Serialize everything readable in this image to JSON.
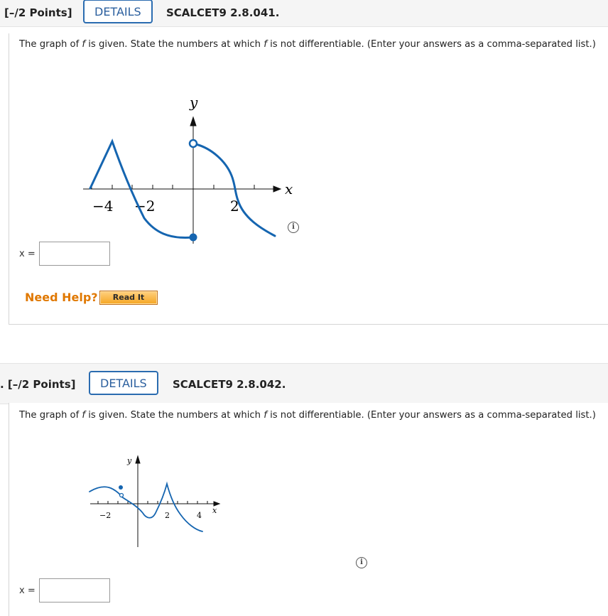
{
  "questions": [
    {
      "points": "[–/2 Points]",
      "details_label": "DETAILS",
      "code": "SCALCET9 2.8.041.",
      "prompt_before": "The graph of ",
      "f_symbol": "f",
      "prompt_middle": " is given. State the numbers at which ",
      "prompt_after": " is not differentiable. (Enter your answers as a comma-separated list.)",
      "graph": {
        "y_label": "y",
        "x_label": "x",
        "tick_labels": [
          "−4",
          "−2",
          "2"
        ]
      },
      "answer_label": "x =",
      "answer_value": "",
      "need_help": "Need Help?",
      "read_it": "Read It",
      "info_symbol": "i"
    },
    {
      "points": ". [–/2 Points]",
      "details_label": "DETAILS",
      "code": "SCALCET9 2.8.042.",
      "prompt_before": "The graph of ",
      "f_symbol": "f",
      "prompt_middle": " is given. State the numbers at which ",
      "prompt_after": " is not differentiable. (Enter your answers as a comma-separated list.)",
      "graph": {
        "y_label": "y",
        "x_label": "x",
        "tick_labels": [
          "−2",
          "2",
          "4"
        ]
      },
      "answer_label": "x =",
      "answer_value": "",
      "info_symbol": "i"
    }
  ],
  "colors": {
    "curve": "#1565b0",
    "details_border": "#2b6cb0",
    "need_help": "#e07800"
  }
}
